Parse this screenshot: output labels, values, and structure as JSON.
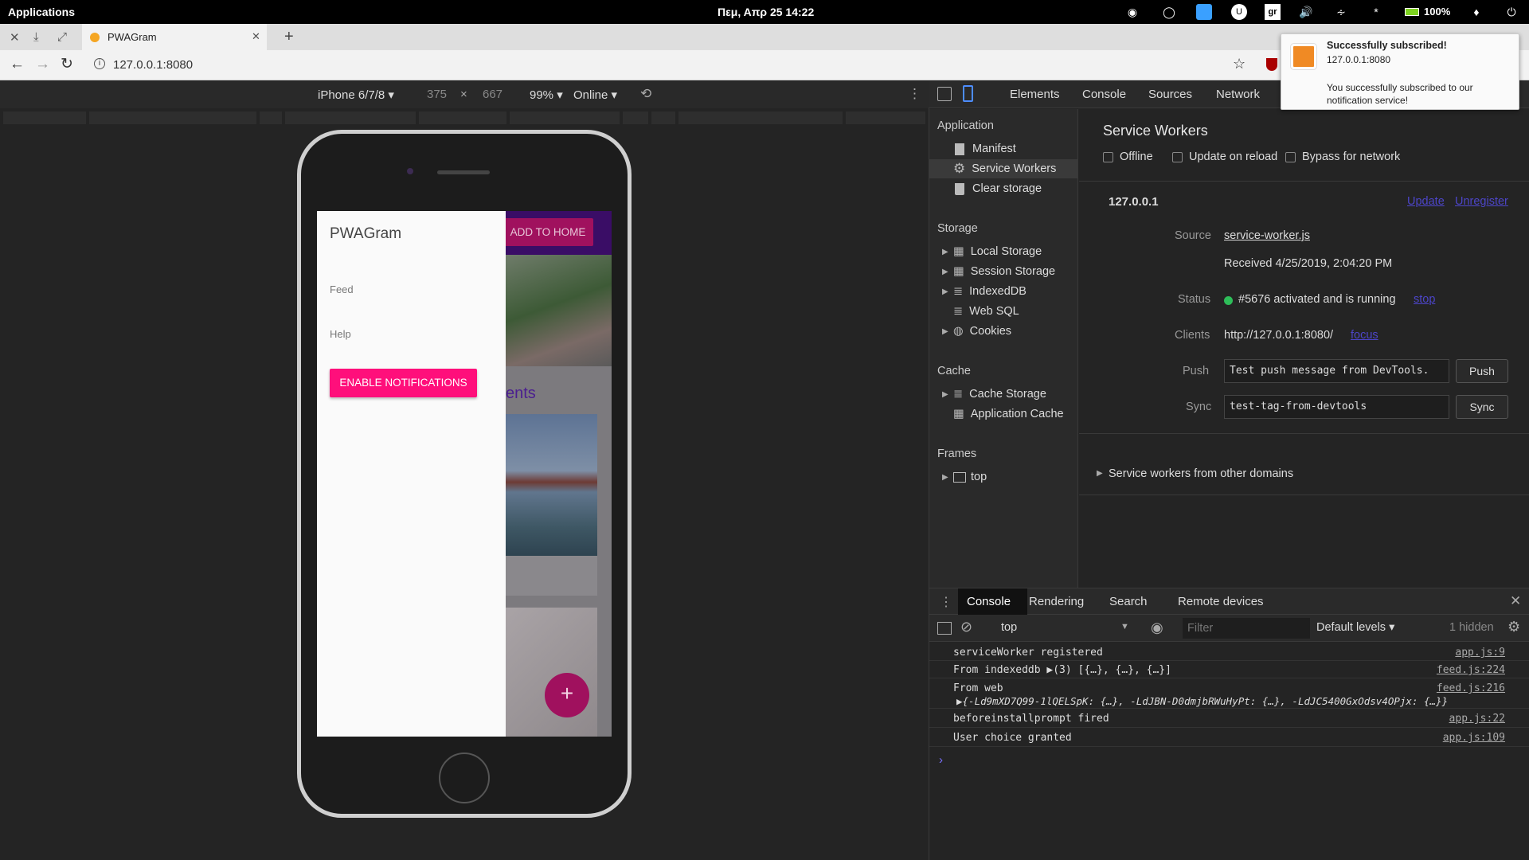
{
  "system_bar": {
    "apps_label": "Applications",
    "clock": "Πεμ, Απρ 25   14:22",
    "battery": "100%"
  },
  "browser": {
    "tab_title": "PWAGram",
    "new_tab": "+",
    "url": "127.0.0.1:8080"
  },
  "device_toolbar": {
    "device": "iPhone 6/7/8",
    "width": "375",
    "times": "×",
    "height": "667",
    "zoom": "99%",
    "network": "Online"
  },
  "app": {
    "title": "PWAGram",
    "add_to_home": "ADD TO HOME",
    "menu_items": [
      "Feed",
      "Help"
    ],
    "enable_notifications": "ENABLE NOTIFICATIONS",
    "section_fragment": "ents",
    "fab": "+"
  },
  "devtools": {
    "tabs": [
      "Elements",
      "Console",
      "Sources",
      "Network"
    ],
    "sidebar": {
      "application_header": "Application",
      "application_items": [
        "Manifest",
        "Service Workers",
        "Clear storage"
      ],
      "storage_header": "Storage",
      "storage_items": [
        "Local Storage",
        "Session Storage",
        "IndexedDB",
        "Web SQL",
        "Cookies"
      ],
      "cache_header": "Cache",
      "cache_items": [
        "Cache Storage",
        "Application Cache"
      ],
      "frames_header": "Frames",
      "frames_items": [
        "top"
      ]
    },
    "service_workers": {
      "title": "Service Workers",
      "options": [
        "Offline",
        "Update on reload",
        "Bypass for network"
      ],
      "origin": "127.0.0.1",
      "update": "Update",
      "unregister": "Unregister",
      "source_label": "Source",
      "source_file": "service-worker.js",
      "received": "Received 4/25/2019, 2:04:20 PM",
      "status_label": "Status",
      "status_text": "#5676 activated and is running",
      "stop": "stop",
      "clients_label": "Clients",
      "clients_url": "http://127.0.0.1:8080/",
      "focus": "focus",
      "push_label": "Push",
      "push_value": "Test push message from DevTools.",
      "push_button": "Push",
      "sync_label": "Sync",
      "sync_value": "test-tag-from-devtools",
      "sync_button": "Sync",
      "other_domains": "Service workers from other domains"
    },
    "drawer_tabs": [
      "Console",
      "Rendering",
      "Search",
      "Remote devices"
    ],
    "console_toolbar": {
      "context": "top",
      "filter_placeholder": "Filter",
      "levels": "Default levels",
      "hidden": "1 hidden"
    },
    "console_lines": [
      {
        "msg": "serviceWorker registered",
        "src": "app.js:9"
      },
      {
        "msg": "From indexeddb ▶(3) [{…}, {…}, {…}]",
        "src": "feed.js:224"
      },
      {
        "msg": "From web",
        "src": "feed.js:216",
        "detail": "▶{-Ld9mXD7Q99-1lQELSpK: {…}, -LdJBN-D0dmjbRWuHyPt: {…}, -LdJC5400GxOdsv4OPjx: {…}}"
      },
      {
        "msg": "beforeinstallprompt fired",
        "src": "app.js:22"
      },
      {
        "msg": "User choice granted",
        "src": "app.js:109"
      }
    ],
    "prompt": "›"
  },
  "notification": {
    "title": "Successfully subscribed!",
    "origin": "127.0.0.1:8080",
    "body": "You successfully subscribed to our notification service!"
  },
  "colors": {
    "accent_pink": "#ff0f7b",
    "app_purple": "#5c1a9e",
    "link": "#7b72ff",
    "status_green": "#2ebd59"
  }
}
